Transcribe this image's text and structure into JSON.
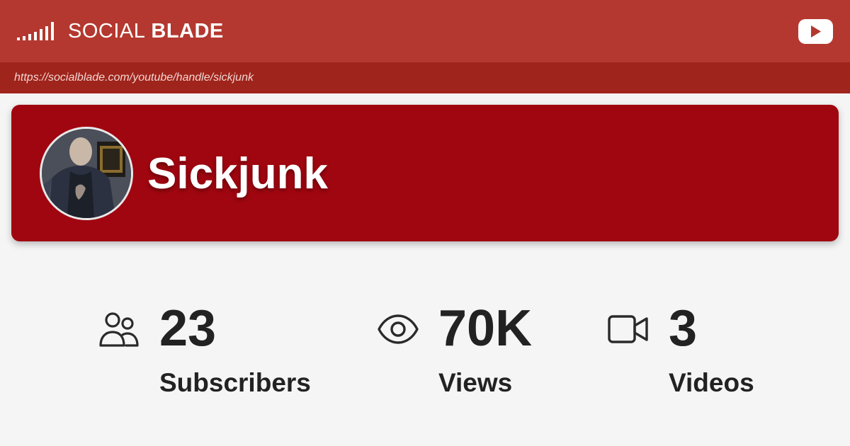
{
  "header": {
    "logo_light": "SOCIAL",
    "logo_bold": "BLADE",
    "logo_icon": "signal-bars-icon",
    "platform_icon": "youtube-play-icon",
    "brand_color": "#b4382f"
  },
  "url_bar": {
    "url": "https://socialblade.com/youtube/handle/sickjunk"
  },
  "channel": {
    "name": "Sickjunk",
    "avatar": "channel-avatar",
    "card_color": "#a00610"
  },
  "stats": [
    {
      "icon": "users-icon",
      "value": "23",
      "label": "Subscribers"
    },
    {
      "icon": "eye-icon",
      "value": "70K",
      "label": "Views"
    },
    {
      "icon": "video-camera-icon",
      "value": "3",
      "label": "Videos"
    }
  ]
}
